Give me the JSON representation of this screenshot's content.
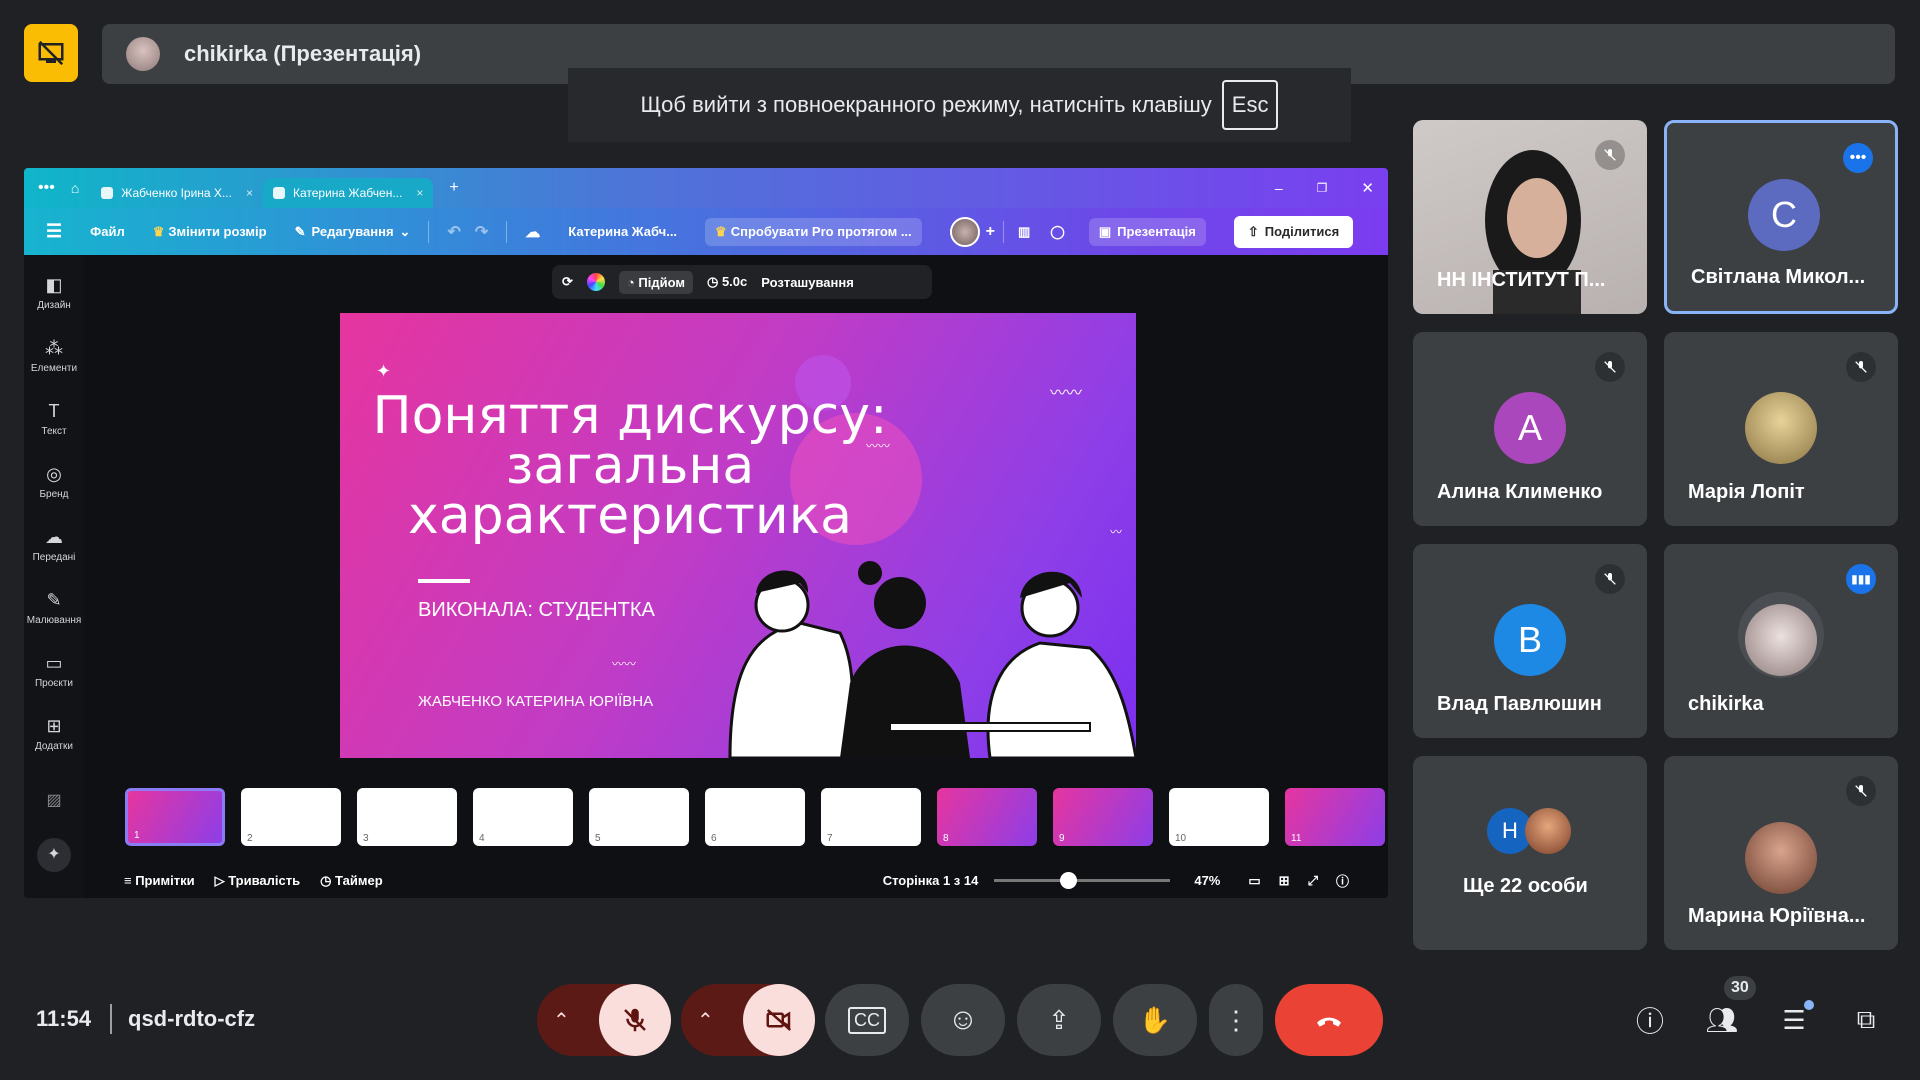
{
  "presenter": {
    "label": "chikirka (Презентація)"
  },
  "fullscreen_toast": {
    "text": "Щоб вийти з повноекранного режиму, натисніть клавішу",
    "key": "Esc"
  },
  "browser": {
    "tabs": [
      {
        "label": "Жабченко Ірина Х..."
      },
      {
        "label": "Катерина Жабчен..."
      }
    ]
  },
  "canva_toolbar": {
    "file": "Файл",
    "resize": "Змінити розмір",
    "editing": "Редагування",
    "doc_title": "Катерина Жабч...",
    "pro_trial": "Спробувати Pro протягом ...",
    "present": "Презентація",
    "share": "Поділитися"
  },
  "left_rail": [
    {
      "label": "Дизайн"
    },
    {
      "label": "Елементи"
    },
    {
      "label": "Текст"
    },
    {
      "label": "Бренд"
    },
    {
      "label": "Передані"
    },
    {
      "label": "Малювання"
    },
    {
      "label": "Проєкти"
    },
    {
      "label": "Додатки"
    }
  ],
  "floating_toolbar": {
    "lift": "Підйом",
    "duration": "5.0с",
    "position": "Розташування"
  },
  "slide": {
    "title": "Поняття дискурсу: загальна характеристика",
    "performed_by": "ВИКОНАЛА: СТУДЕНТКА",
    "author": "ЖАБЧЕНКО КАТЕРИНА ЮРІЇВНА"
  },
  "thumbnails": [
    "1",
    "2",
    "3",
    "4",
    "5",
    "6",
    "7",
    "8",
    "9",
    "10",
    "11"
  ],
  "bottom_strip": {
    "notes": "Примітки",
    "duration": "Тривалість",
    "timer": "Таймер",
    "page": "Сторінка 1 з 14",
    "zoom": "47%"
  },
  "participants": [
    {
      "name": "НН ІНСТИТУТ П...",
      "type": "video"
    },
    {
      "name": "Світлана Микол...",
      "letter": "С",
      "color": "#5c6bc0"
    },
    {
      "name": "Алина Клименко",
      "letter": "А",
      "color": "#ab47bc"
    },
    {
      "name": "Марія Лопіт"
    },
    {
      "name": "Влад Павлюшин",
      "letter": "В",
      "color": "#1e88e5"
    },
    {
      "name": "chikirka"
    },
    {
      "name": "Ще 22 особи",
      "letter": "Н",
      "color": "#1565c0"
    },
    {
      "name": "Марина Юріївна..."
    }
  ],
  "footer": {
    "time": "11:54",
    "meeting_code": "qsd-rdto-cfz",
    "people_count": "30"
  },
  "colors": {
    "hangup": "#ea4335",
    "muted_bg": "#f9dedc",
    "badge": "#fbbc04",
    "speaking": "#1a73e8"
  }
}
